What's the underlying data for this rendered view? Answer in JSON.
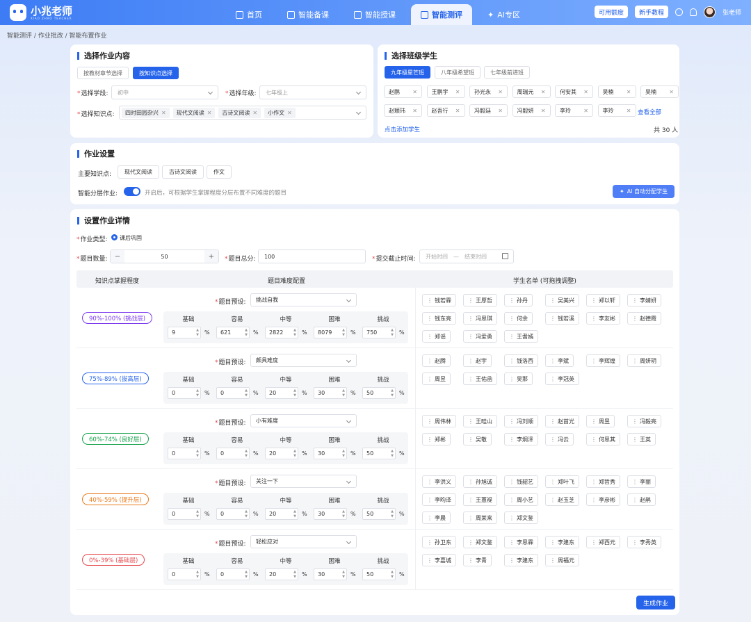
{
  "app": {
    "logo_text": "小兆老师",
    "logo_sub": "XIAO ZHAO TEACHER"
  },
  "nav": [
    {
      "label": "首页",
      "icon": "home-icon",
      "active": false
    },
    {
      "label": "智能备课",
      "icon": "book-icon",
      "active": false
    },
    {
      "label": "智能授课",
      "icon": "open-book-icon",
      "active": false
    },
    {
      "label": "智能测评",
      "icon": "chat-icon",
      "active": true
    },
    {
      "label": "AI专区",
      "icon": "sparkle-icon",
      "active": false
    }
  ],
  "header_right": {
    "quota": "可用额度",
    "tutorial": "新手教程",
    "user": "张老师"
  },
  "breadcrumb": "智能测评 / 作业批改 / 智能布置作业",
  "content": {
    "title": "选择作业内容",
    "tabs": [
      "按教材章节选择",
      "按知识点选择"
    ],
    "stage_label": "选择学段:",
    "stage_value": "初中",
    "grade_label": "选择年级:",
    "grade_value": "七年级上",
    "knowledge_label": "选择知识点:",
    "knowledge_tags": [
      "四时田园杂兴",
      "现代文阅读",
      "古诗文阅读",
      "小作文"
    ]
  },
  "students": {
    "title": "选择班级学生",
    "classes": [
      "九年级星芒班",
      "八年级希望班",
      "七年级前进班"
    ],
    "list": [
      "赵鹏",
      "王鹏宇",
      "孙光永",
      "周瑞元",
      "何安其",
      "吴楠",
      "吴楠",
      "赵颖玮",
      "赵吾行",
      "冯毅廷",
      "冯毅妍",
      "李玲",
      "李玲"
    ],
    "view_all": "查看全部",
    "add": "点击添加学生",
    "total": "共 30 人"
  },
  "settings": {
    "title": "作业设置",
    "main_label": "主要知识点:",
    "main_points": [
      "现代文阅读",
      "古诗文阅读",
      "作文"
    ],
    "layer_label": "智能分层作业:",
    "layer_hint": "开启后，可根据学生掌握程度分层布置不同难度的题目",
    "ai_btn": "AI 自动分配学生"
  },
  "details": {
    "title": "设置作业详情",
    "type_label": "作业类型:",
    "type_value": "课后巩固",
    "count_label": "题目数量:",
    "count_value": "50",
    "score_label": "题目总分:",
    "score_value": "100",
    "deadline_label": "提交截止时间:",
    "start_ph": "开始时间",
    "end_ph": "结束时间",
    "col_level": "知识点掌握程度",
    "col_config": "题目难度配置",
    "col_students": "学生名单 (可拖拽调整)",
    "preset_label": "题目预设:",
    "diff_labels": [
      "基础",
      "容易",
      "中等",
      "困难",
      "挑战"
    ],
    "pct": "%",
    "submit": "生成作业"
  },
  "rows": [
    {
      "level": "90%-100% (挑战层)",
      "color": "#7c3aed",
      "preset": "挑战自我",
      "values": [
        "9",
        "621",
        "2822",
        "8079",
        "750"
      ],
      "students": [
        "钱若霖",
        "王厚哲",
        "孙丹",
        "吴美兴",
        "郑以轩",
        "李婧妍",
        "钱东亮",
        "冯思琪",
        "何余",
        "钱若溪",
        "李友彬",
        "赵德霞",
        "郑谣",
        "冯爱勇",
        "王耆嫣"
      ]
    },
    {
      "level": "75%-89% (拔高层)",
      "color": "#2563eb",
      "preset": "颇具难度",
      "values": [
        "0",
        "0",
        "20",
        "30",
        "50"
      ],
      "students": [
        "赵腾",
        "赵宇",
        "钱洛西",
        "李斌",
        "李辉煌",
        "周妍玥",
        "周昱",
        "王佑函",
        "吴那",
        "李冠英"
      ]
    },
    {
      "level": "60%-74% (良好层)",
      "color": "#16a34a",
      "preset": "小有难度",
      "values": [
        "0",
        "0",
        "20",
        "30",
        "50"
      ],
      "students": [
        "周伟林",
        "王畦山",
        "冯刘顺",
        "赵首光",
        "周昱",
        "冯毅亮",
        "郑彬",
        "吴敬",
        "李炯泽",
        "冯云",
        "何思其",
        "王英"
      ]
    },
    {
      "level": "40%-59% (提升层)",
      "color": "#ea7a1a",
      "preset": "关注一下",
      "values": [
        "0",
        "0",
        "20",
        "30",
        "50"
      ],
      "students": [
        "李洪义",
        "孙旭诚",
        "钱韶艺",
        "郑叶飞",
        "郑哲秀",
        "李丽",
        "李昀泽",
        "王蕙褆",
        "周小艺",
        "赵玉芝",
        "李彦彬",
        "赵鹃",
        "李晨",
        "周莱来",
        "郑文鉴"
      ]
    },
    {
      "level": "0%-39% (基础层)",
      "color": "#e5484d",
      "preset": "轻松应对",
      "values": [
        "0",
        "0",
        "20",
        "30",
        "50"
      ],
      "students": [
        "孙卫东",
        "郑文鉴",
        "李思霖",
        "李建东",
        "郑西元",
        "李秀英",
        "李嘉城",
        "李青",
        "李建东",
        "周福元"
      ]
    }
  ]
}
